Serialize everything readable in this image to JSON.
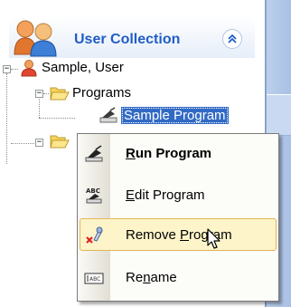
{
  "header": {
    "title": "User Collection",
    "icon": "users-icon",
    "collapse_icon": "chevron-double-up-icon"
  },
  "tree": {
    "user": {
      "label": "Sample, User",
      "icon": "user-icon"
    },
    "programs": {
      "label": "Programs",
      "icon": "folder-open-icon"
    },
    "selected_program": {
      "label": "Sample Program",
      "icon": "program-icon"
    }
  },
  "context_menu": {
    "items": [
      {
        "label": "Run Program",
        "mnemonic": "R",
        "rest": "un Program",
        "icon": "run-icon",
        "bold": true
      },
      {
        "label": "Edit Program",
        "mnemonic": "E",
        "rest": "dit Program",
        "icon": "edit-icon"
      },
      {
        "label": "Remove Program",
        "before": "Remove ",
        "mnemonic": "P",
        "rest": "rogram",
        "icon": "remove-icon",
        "highlighted": true
      },
      {
        "label": "Rename",
        "before": "Re",
        "mnemonic": "n",
        "rest": "ame",
        "icon": "rename-icon"
      }
    ]
  },
  "colors": {
    "accent": "#215dc6",
    "selection": "#316ac5",
    "hover": "#fdf4c9"
  }
}
